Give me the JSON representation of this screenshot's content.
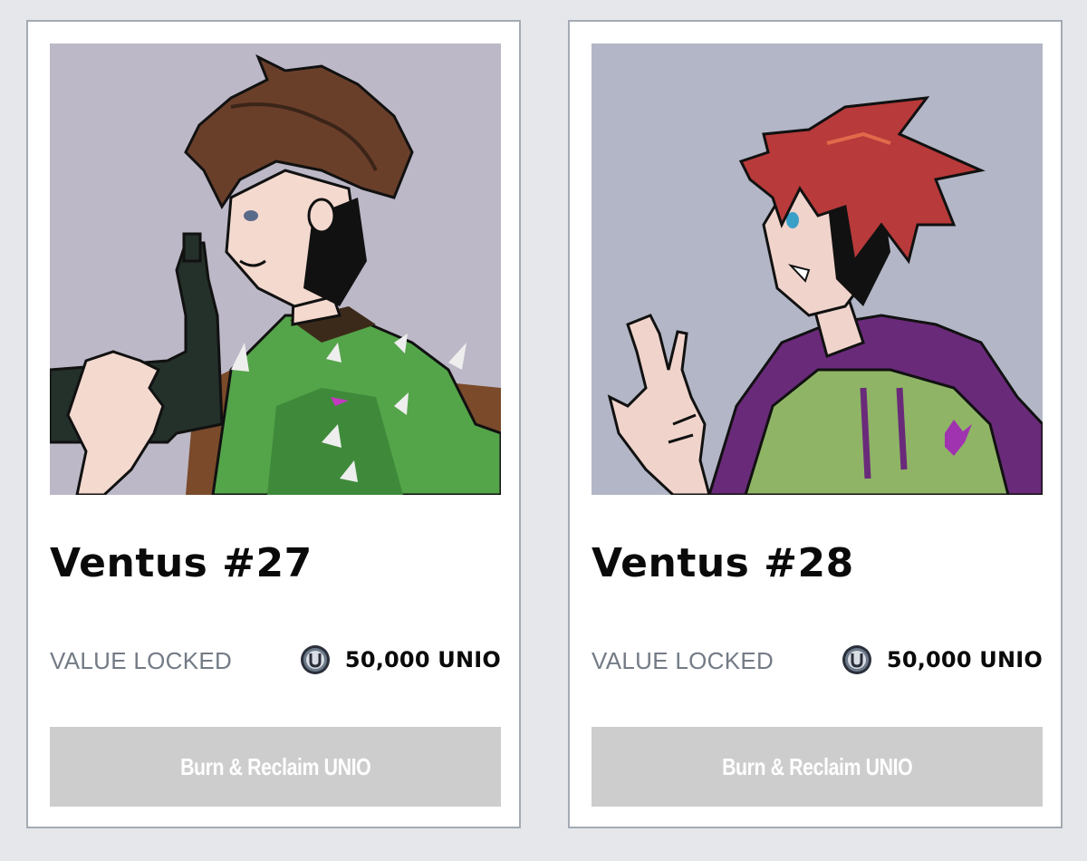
{
  "cards": [
    {
      "title": "Ventus #27",
      "value_label": "VALUE LOCKED",
      "amount": "50,000 UNIO",
      "button_label": "Burn & Reclaim UNIO",
      "art_bg": "#bcb8c7"
    },
    {
      "title": "Ventus #28",
      "value_label": "VALUE LOCKED",
      "amount": "50,000 UNIO",
      "button_label": "Burn & Reclaim UNIO",
      "art_bg": "#b3b6c6"
    }
  ],
  "colors": {
    "page_bg": "#e5e7ea",
    "card_border": "#a4abb4",
    "label_gray": "#737b85",
    "button_disabled": "#cdcdcd"
  },
  "icons": {
    "token": "unio-coin-icon"
  }
}
